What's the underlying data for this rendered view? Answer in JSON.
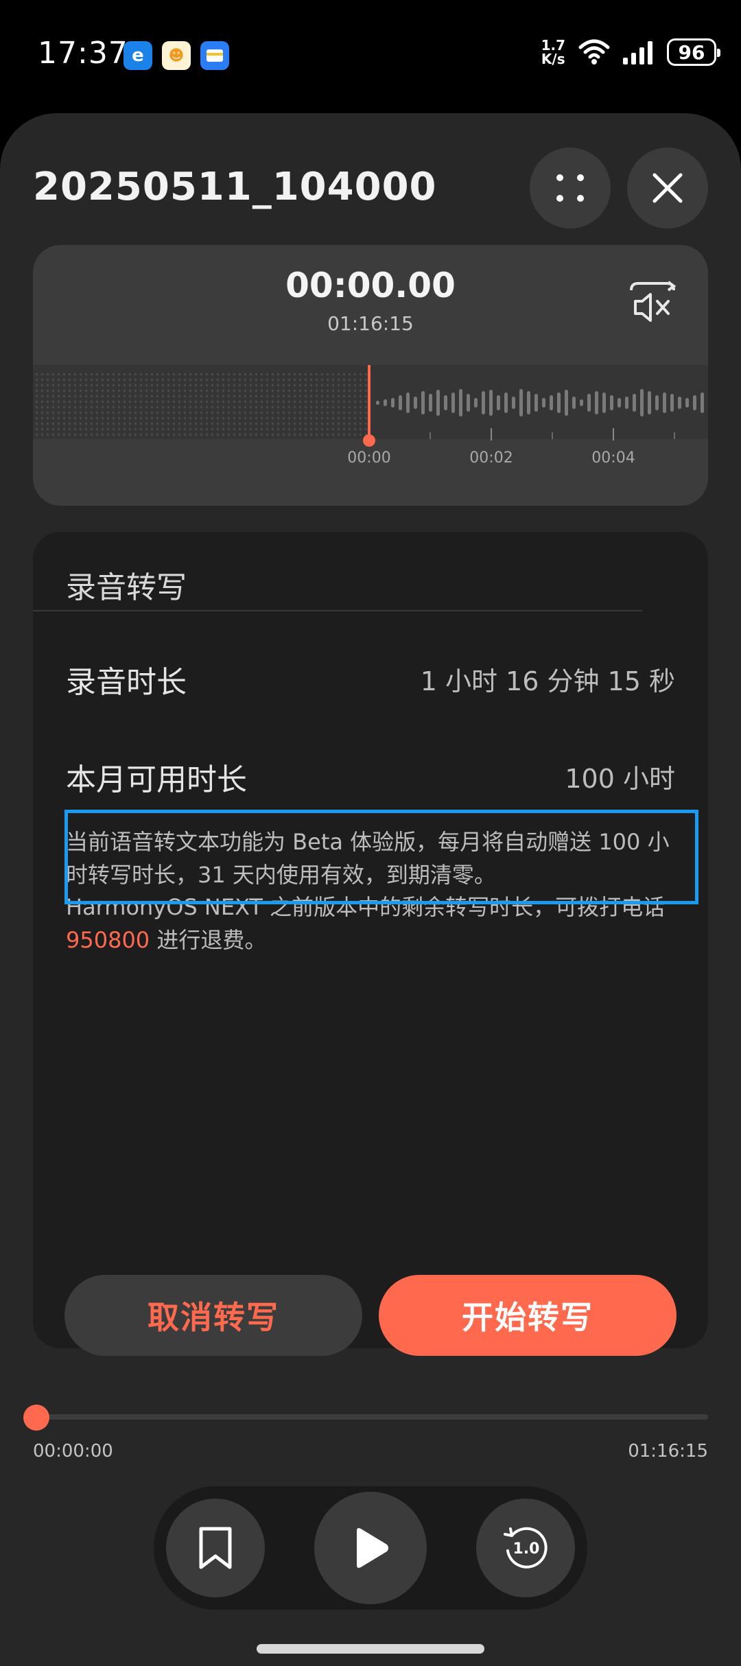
{
  "status": {
    "time": "17:37",
    "net_speed_top": "1.7",
    "net_speed_bottom": "K/s",
    "battery": "96",
    "app_icons": [
      "edge-browser-icon",
      "delivery-app-icon",
      "wallet-app-icon"
    ]
  },
  "header": {
    "title": "20250511_104000"
  },
  "player": {
    "current_time": "00:00.00",
    "total_time": "01:16:15",
    "ticks": [
      "00:00",
      "00:02",
      "00:04"
    ]
  },
  "transcribe": {
    "heading": "录音转写",
    "duration_label": "录音时长",
    "duration_value": "1 小时 16 分钟 15 秒",
    "available_label": "本月可用时长",
    "available_value": "100 小时",
    "note_1": "当前语音转文本功能为 Beta 体验版，每月将自动赠送 100 小时转写时长，31 天内使用有效，到期清零。",
    "note_2_prefix": "HarmonyOS NEXT 之前版本中的剩余转写时长，可拨打电话 ",
    "note_2_phone": "950800",
    "note_2_suffix": " 进行退费。",
    "cancel_label": "取消转写",
    "start_label": "开始转写"
  },
  "progress": {
    "start": "00:00:00",
    "end": "01:16:15",
    "fraction": 0.0
  },
  "controls": {
    "speed": "1.0"
  },
  "colors": {
    "accent": "#ff6a4e",
    "highlight_box": "#1b9bf0",
    "sheet_bg": "#272727"
  }
}
